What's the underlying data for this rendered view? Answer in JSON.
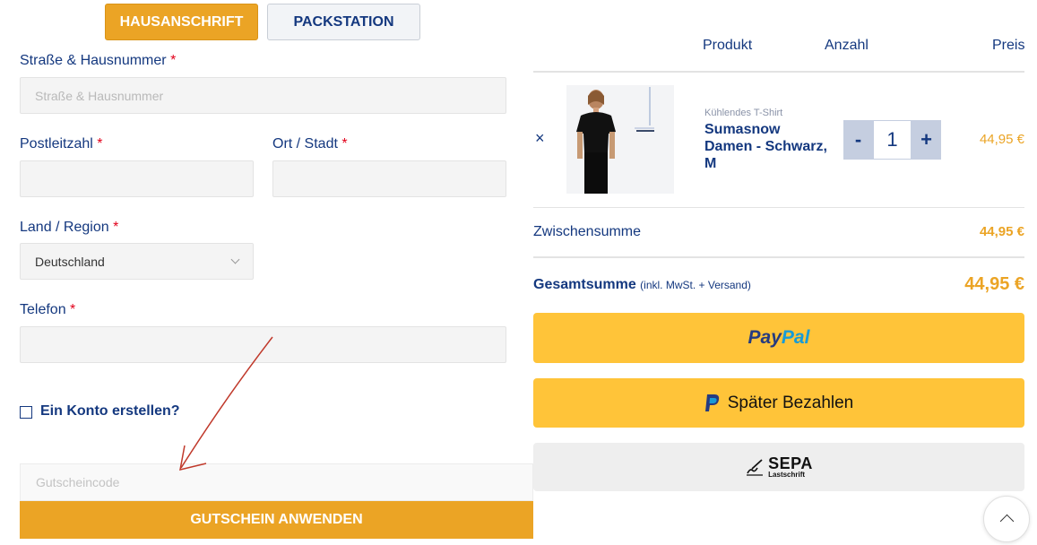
{
  "tabs": {
    "home_address": "HAUSANSCHRIFT",
    "packstation": "PACKSTATION"
  },
  "form": {
    "street": {
      "label": "Straße & Hausnummer",
      "required": "*",
      "placeholder": "Straße & Hausnummer"
    },
    "zip": {
      "label": "Postleitzahl",
      "required": "*",
      "value": ""
    },
    "city": {
      "label": "Ort / Stadt",
      "required": "*",
      "value": ""
    },
    "country": {
      "label": "Land / Region",
      "required": "*",
      "value": "Deutschland"
    },
    "phone": {
      "label": "Telefon",
      "required": "*",
      "value": ""
    },
    "create_account": "Ein Konto erstellen?",
    "coupon": {
      "placeholder": "Gutscheincode",
      "button": "GUTSCHEIN ANWENDEN"
    }
  },
  "cart": {
    "headers": {
      "product": "Produkt",
      "quantity": "Anzahl",
      "price": "Preis"
    },
    "items": [
      {
        "remove": "×",
        "category": "Kühlendes T-Shirt",
        "name": "Sumasnow Damen - Schwarz, M",
        "minus": "-",
        "quantity": "1",
        "plus": "+",
        "price": "44,95 €"
      }
    ],
    "subtotal": {
      "label": "Zwischensumme",
      "value": "44,95 €"
    },
    "total": {
      "label": "Gesamtsumme",
      "note": "(inkl. MwSt. + Versand)",
      "value": "44,95 €"
    }
  },
  "payment": {
    "paypal": {
      "pay": "Pay",
      "pal": "Pal"
    },
    "pay_later": {
      "label": "Später Bezahlen"
    },
    "sepa": {
      "big": "SEPA",
      "small": "Lastschrift"
    }
  },
  "colors": {
    "accent": "#eba425",
    "navy": "#14387f",
    "paypal_yellow": "#ffc439",
    "required": "#e2001a"
  },
  "icons": {
    "remove": "close-icon",
    "select": "chevron-down-icon",
    "scroll": "chevron-up-icon",
    "paylater": "paypal-p-icon",
    "sepa": "sepa-signature-icon"
  }
}
